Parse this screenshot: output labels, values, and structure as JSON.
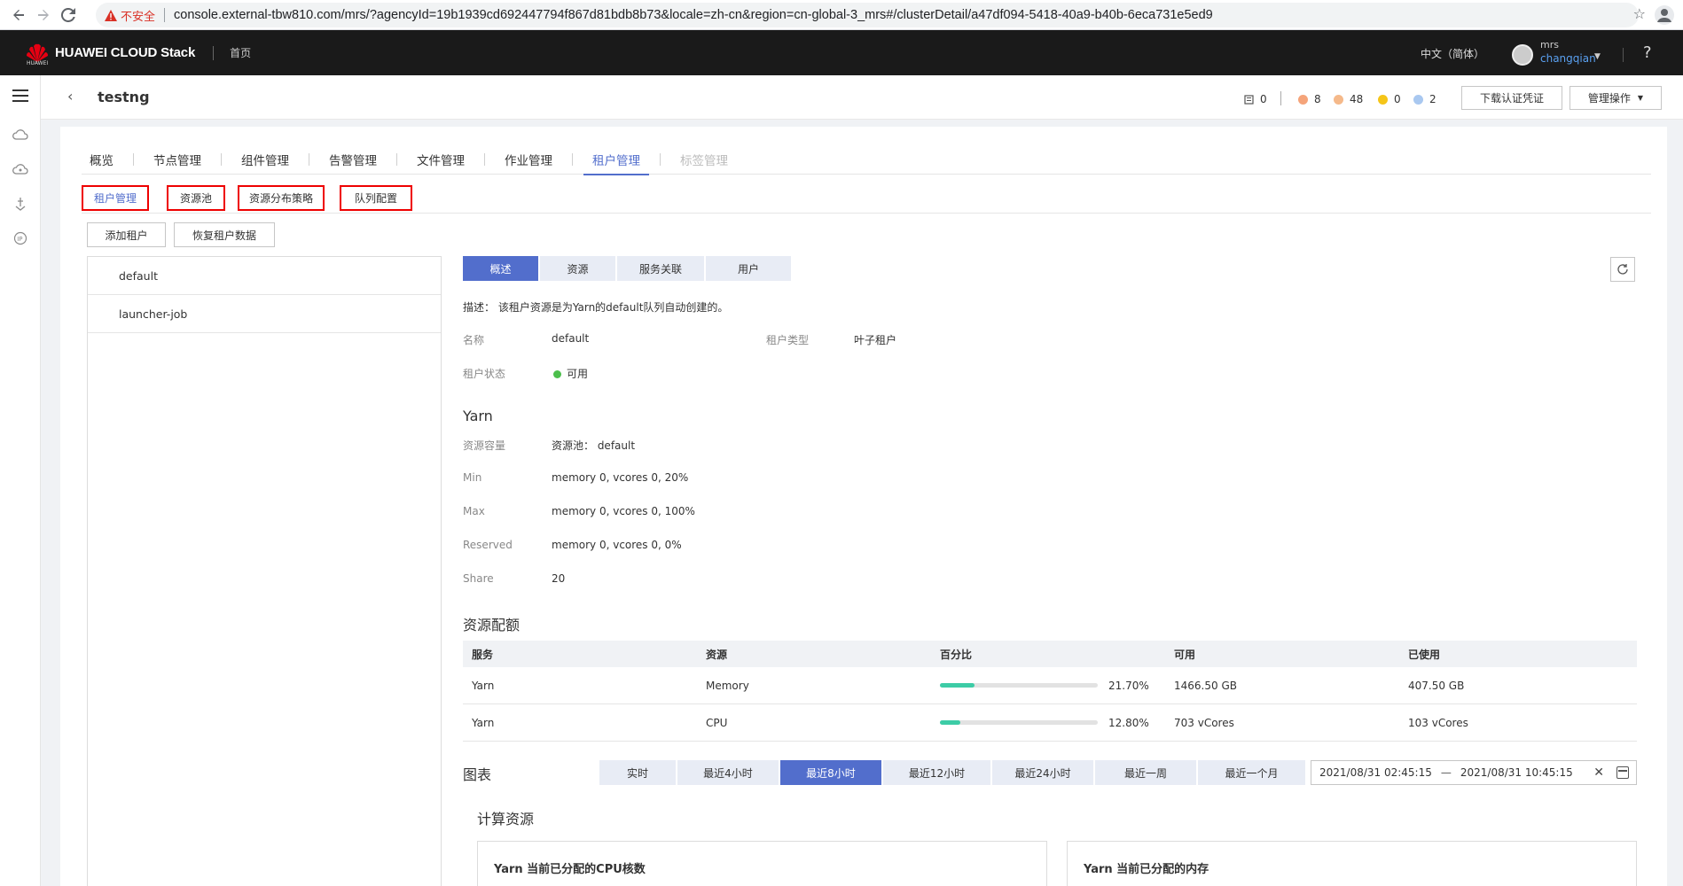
{
  "browser": {
    "insecure_label": "不安全",
    "url": "console.external-tbw810.com/mrs/?agencyId=19b1939cd692447794f867d81bdb8b73&locale=zh-cn&region=cn-global-3_mrs#/clusterDetail/a47df094-5418-40a9-b40b-6eca731e5ed9"
  },
  "header": {
    "brand": "HUAWEI CLOUD Stack",
    "brand_sub": "HUAWEI",
    "home": "首页",
    "language": "中文（简体）",
    "user_line1": "mrs",
    "user_line2": "changqian",
    "help": "?"
  },
  "title_bar": {
    "title": "testng",
    "stats": [
      {
        "name": "host",
        "value": "0",
        "color": "#555555"
      },
      {
        "name": "critical",
        "value": "8",
        "color": "#f5a47a"
      },
      {
        "name": "major",
        "value": "48",
        "color": "#f5b98a"
      },
      {
        "name": "minor",
        "value": "0",
        "color": "#f5c518"
      },
      {
        "name": "warning",
        "value": "2",
        "color": "#a9c8f0"
      }
    ],
    "download_btn": "下载认证凭证",
    "manage_btn": "管理操作"
  },
  "tabs": [
    "概览",
    "节点管理",
    "组件管理",
    "告警管理",
    "文件管理",
    "作业管理",
    "租户管理",
    "标签管理"
  ],
  "active_tab": "租户管理",
  "subtabs": [
    "租户管理",
    "资源池",
    "资源分布策略",
    "队列配置"
  ],
  "actions": {
    "add_tenant": "添加租户",
    "restore": "恢复租户数据"
  },
  "tenants": [
    "default",
    "launcher-job"
  ],
  "detail_tabs": [
    "概述",
    "资源",
    "服务关联",
    "用户"
  ],
  "overview": {
    "desc": "描述： 该租户资源是为Yarn的default队列自动创建的。",
    "name_label": "名称",
    "name_value": "default",
    "type_label": "租户类型",
    "type_value": "叶子租户",
    "status_label": "租户状态",
    "status_value": "可用"
  },
  "yarn": {
    "title": "Yarn",
    "rows": [
      {
        "label": "资源容量",
        "value": "资源池： default"
      },
      {
        "label": "Min",
        "value": "memory 0, vcores 0, 20%"
      },
      {
        "label": "Max",
        "value": "memory 0, vcores 0, 100%"
      },
      {
        "label": "Reserved",
        "value": "memory 0, vcores 0, 0%"
      },
      {
        "label": "Share",
        "value": "20"
      }
    ]
  },
  "quota": {
    "title": "资源配额",
    "headers": [
      "服务",
      "资源",
      "百分比",
      "可用",
      "已使用"
    ],
    "rows": [
      {
        "service": "Yarn",
        "resource": "Memory",
        "percent": 21.7,
        "percent_text": "21.70%",
        "available": "1466.50 GB",
        "used": "407.50 GB"
      },
      {
        "service": "Yarn",
        "resource": "CPU",
        "percent": 12.8,
        "percent_text": "12.80%",
        "available": "703 vCores",
        "used": "103 vCores"
      }
    ]
  },
  "chart_filter": {
    "title": "图表",
    "ranges": [
      "实时",
      "最近4小时",
      "最近8小时",
      "最近12小时",
      "最近24小时",
      "最近一周",
      "最近一个月"
    ],
    "active_range": "最近8小时",
    "date_start": "2021/08/31 02:45:15",
    "date_sep": "—",
    "date_end": "2021/08/31 10:45:15"
  },
  "compute": {
    "title": "计算资源",
    "cards": [
      "Yarn 当前已分配的CPU核数",
      "Yarn 当前已分配的内存"
    ]
  }
}
